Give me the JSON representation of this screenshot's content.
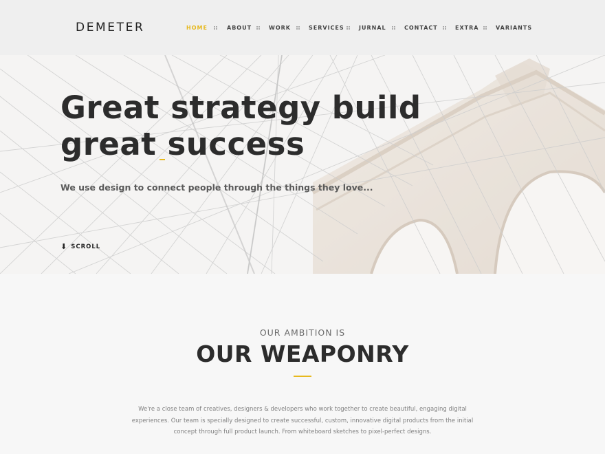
{
  "header": {
    "logo": "DEMETER",
    "nav": [
      {
        "label": "HOME",
        "active": true
      },
      {
        "label": "ABOUT",
        "active": false
      },
      {
        "label": "WORK",
        "active": false
      },
      {
        "label": "SERVICES",
        "active": false
      },
      {
        "label": "JURNAL",
        "active": false
      },
      {
        "label": "CONTACT",
        "active": false
      },
      {
        "label": "EXTRA",
        "active": false
      },
      {
        "label": "VARIANTS",
        "active": false
      }
    ]
  },
  "hero": {
    "title_line1": "Great strategy build",
    "title_line2": "great success",
    "subtitle": "We use design to connect people through the things they love...",
    "scroll_icon": "arrow-down-icon",
    "scroll_label": "SCROLL",
    "background": "bridge-photo"
  },
  "about": {
    "kicker": "OUR AMBITION IS",
    "heading": "OUR WEAPONRY",
    "body": "We're a close team of creatives, designers & developers who work together to create beautiful, engaging digital experiences. Our team is specially designed to create successful, custom, innovative digital products from the initial concept through full product launch. From whiteboard sketches to pixel-perfect designs."
  },
  "colors": {
    "accent": "#e7b91e",
    "text_dark": "#2c2c2c",
    "header_bg": "#efefef",
    "page_bg": "#f7f7f7"
  }
}
